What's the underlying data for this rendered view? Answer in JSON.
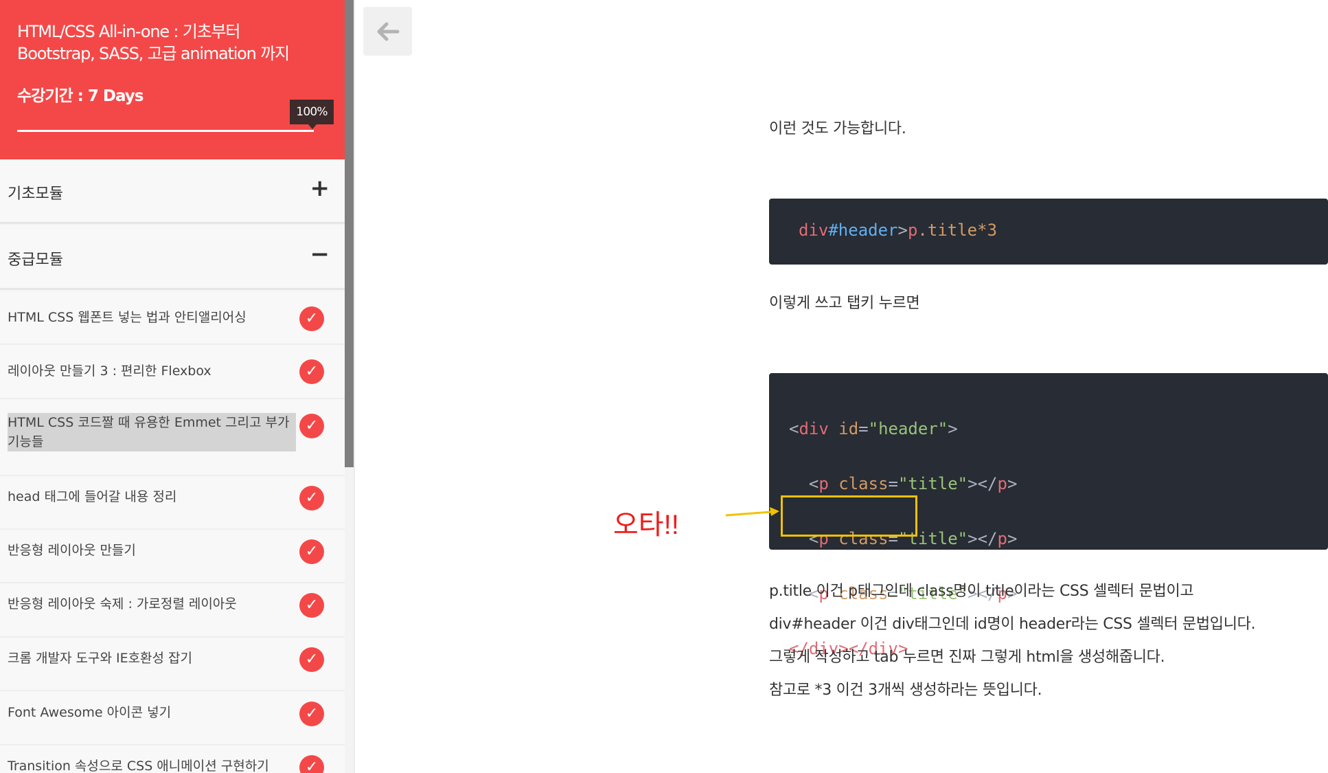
{
  "sidebar": {
    "course_title": "HTML/CSS All-in-one : 기초부터 Bootstrap, SASS, 고급 animation 까지",
    "period": "수강기간 : 7 Days",
    "progress_label": "100%",
    "progress_value": 1.0,
    "modules": [
      {
        "title": "기초모듈",
        "toggle": "+"
      },
      {
        "title": "중급모듈",
        "toggle": "−"
      }
    ],
    "lessons": [
      {
        "title": "HTML CSS 웹폰트 넣는 법과 안티앨리어싱",
        "done": true
      },
      {
        "title": "레이아웃 만들기 3 : 편리한 Flexbox",
        "done": true
      },
      {
        "title": "HTML CSS 코드짤 때 유용한 Emmet 그리고 부가기능들",
        "done": true
      },
      {
        "title": "head 태그에 들어갈 내용 정리",
        "done": true
      },
      {
        "title": "반응형 레이아웃 만들기",
        "done": true
      },
      {
        "title": "반응형 레이아웃 숙제 : 가로정렬 레이아웃",
        "done": true
      },
      {
        "title": "크롬 개발자 도구와 IE호환성 잡기",
        "done": true
      },
      {
        "title": "Font Awesome 아이콘 넣기",
        "done": true
      },
      {
        "title": "Transition 속성으로 CSS 애니메이션 구현하기",
        "done": true
      }
    ]
  },
  "colors": {
    "accent": "#f44848",
    "code_bg": "#282c34",
    "annotation_box": "#f2c200",
    "annotation_text": "#ee1c1c"
  },
  "main": {
    "back_icon": "arrow-left-icon",
    "para1": "이런 것도 가능합니다.",
    "code1": {
      "t1": "div",
      "t2": "#header",
      "t3": ">",
      "t4": "p",
      "t5": ".title",
      "t6": "*3"
    },
    "para2": "이렇게 쓰고 탭키 누르면",
    "code2": {
      "lt": "<",
      "gt": ">",
      "div": "div",
      "p": "p",
      "id_attr": "id",
      "class_attr": "class",
      "eq": "=",
      "header_val": "\"header\"",
      "title_val": "\"title\"",
      "close_p": "</",
      "close_div_1": "</div>",
      "close_div_2": "</div>"
    },
    "annotation": "오타!!",
    "explain": [
      "p.title 이건 p태그인데 class명이 title이라는 CSS 셀렉터 문법이고",
      "div#header 이건 div태그인데 id명이 header라는 CSS 셀렉터 문법입니다.",
      "그렇게 작성하고 tab 누르면 진짜 그렇게 html을 생성해줍니다.",
      "참고로 *3 이건 3개씩 생성하라는 뜻입니다."
    ]
  }
}
